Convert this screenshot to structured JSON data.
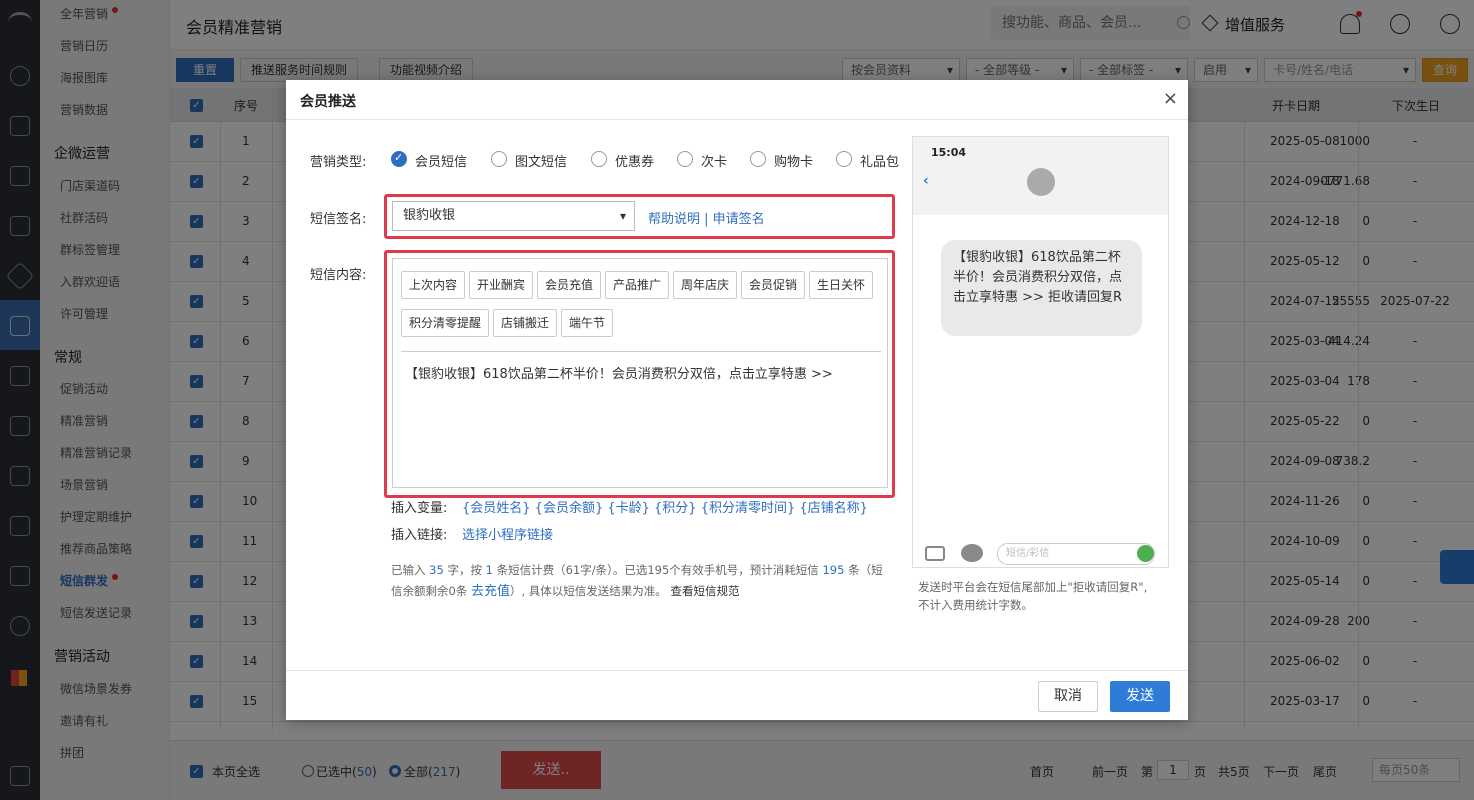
{
  "sidebar": {
    "items": [
      "全年营销",
      "营销日历",
      "海报图库",
      "营销数据"
    ],
    "group1": "企微运营",
    "group1_items": [
      "门店渠道码",
      "社群活码",
      "群标签管理",
      "入群欢迎语",
      "许可管理"
    ],
    "group2": "常规",
    "group2_items": [
      "促销活动",
      "精准营销",
      "精准营销记录",
      "场景营销",
      "护理定期维护",
      "推荐商品策略",
      "短信群发",
      "短信发送记录"
    ],
    "group3": "营销活动",
    "group3_items": [
      "微信场景发券",
      "邀请有礼",
      "拼团"
    ]
  },
  "header": {
    "title": "会员精准营销",
    "search_placeholder": "搜功能、商品、会员...",
    "vas": "增值服务"
  },
  "toolbar": {
    "reset": "重置",
    "rule": "推送服务时间规则",
    "video": "功能视频介绍",
    "filter1": "按会员资料",
    "filter2": "- 全部等级 -",
    "filter3": "- 全部标签 -",
    "filter4": "启用",
    "card_placeholder": "卡号/姓名/电话",
    "query": "查询"
  },
  "table": {
    "headers": {
      "seq": "序号",
      "open_date": "开卡日期",
      "next_bday": "下次生日"
    },
    "rows": [
      {
        "seq": "1",
        "val": "1000",
        "date": "2025-05-08",
        "bday": "-"
      },
      {
        "seq": "2",
        "val": "0771.68",
        "date": "2024-09-18",
        "bday": "-"
      },
      {
        "seq": "3",
        "val": "0",
        "date": "2024-12-18",
        "bday": "-"
      },
      {
        "seq": "4",
        "val": "0",
        "date": "2025-05-12",
        "bday": "-"
      },
      {
        "seq": "5",
        "val": "55555",
        "date": "2024-07-12",
        "bday": "2025-07-22"
      },
      {
        "seq": "6",
        "val": "414.24",
        "date": "2025-03-04",
        "bday": "-"
      },
      {
        "seq": "7",
        "val": "178",
        "date": "2025-03-04",
        "bday": "-"
      },
      {
        "seq": "8",
        "val": "0",
        "date": "2025-05-22",
        "bday": "-"
      },
      {
        "seq": "9",
        "val": "738.2",
        "date": "2024-09-08",
        "bday": "-"
      },
      {
        "seq": "10",
        "val": "0",
        "date": "2024-11-26",
        "bday": "-"
      },
      {
        "seq": "11",
        "val": "0",
        "date": "2024-10-09",
        "bday": "-"
      },
      {
        "seq": "12",
        "val": "0",
        "date": "2025-05-14",
        "bday": "-"
      },
      {
        "seq": "13",
        "val": "200",
        "date": "2024-09-28",
        "bday": "-"
      },
      {
        "seq": "14",
        "val": "0",
        "date": "2025-06-02",
        "bday": "-"
      },
      {
        "seq": "15",
        "val": "0",
        "date": "2025-03-17",
        "bday": "-"
      }
    ]
  },
  "footer": {
    "select_all": "本页全选",
    "selected_label": "已选中(",
    "selected_count": "50",
    "all_label": "全部(",
    "all_count": "217",
    "send": "发送..",
    "first": "首页",
    "prev": "前一页",
    "page_prefix": "第",
    "page": "1",
    "page_suffix": "页",
    "total": "共5页",
    "next": "下一页",
    "last": "尾页",
    "per_page": "每页50条"
  },
  "modal": {
    "title": "会员推送",
    "type_label": "营销类型:",
    "types": [
      "会员短信",
      "图文短信",
      "优惠券",
      "次卡",
      "购物卡",
      "礼品包"
    ],
    "sig_label": "短信签名:",
    "sig_value": "银豹收银",
    "sig_help": "帮助说明 | 申请签名",
    "content_label": "短信内容:",
    "tags": [
      "上次内容",
      "开业酬宾",
      "会员充值",
      "产品推广",
      "周年店庆",
      "会员促销",
      "生日关怀",
      "积分清零提醒",
      "店铺搬迁",
      "端午节"
    ],
    "content": "【银豹收银】618饮品第二杯半价！会员消费积分双倍，点击立享特惠 >>",
    "insert_var_label": "插入变量:",
    "vars": "{会员姓名} {会员余额} {卡龄} {积分} {积分清零时间} {店铺名称}",
    "insert_link_label": "插入链接:",
    "link": "选择小程序链接",
    "info1a": "已输入",
    "info1_count": "35",
    "info1b": "字，按",
    "info1_n": "1",
    "info1c": "条短信计费（61字/条）。已选195个有效手机号，预计消耗短信",
    "info1_total": "195",
    "info1d": "条（短",
    "info2a": "信余额剩余0条",
    "recharge": "去充值",
    "info2b": "）, 具体以短信发送结果为准。",
    "rules": "查看短信规范",
    "phone_time": "15:04",
    "bubble": "【银豹收银】618饮品第二杯半价！会员消费积分双倍，点击立享特惠 >> 拒收请回复R",
    "phone_input": "短信/彩信",
    "note1": "发送时平台会在短信尾部加上\"拒收请回复R\",",
    "note2": "不计入费用统计字数。",
    "cancel": "取消",
    "send": "发送",
    "close": "×"
  }
}
